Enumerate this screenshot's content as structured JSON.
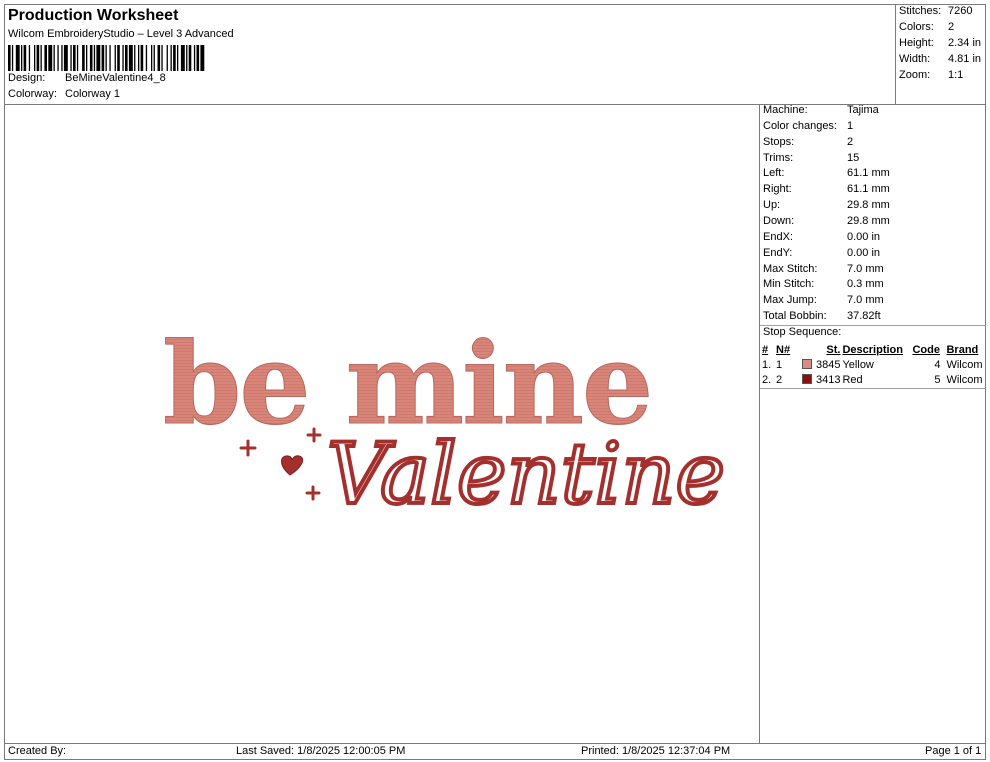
{
  "header": {
    "title": "Production Worksheet",
    "subtitle": "Wilcom EmbroideryStudio – Level 3 Advanced",
    "design_label": "Design:",
    "design_value": "BeMineValentine4_8",
    "colorway_label": "Colorway:",
    "colorway_value": "Colorway 1"
  },
  "summary": {
    "stitches_label": "Stitches:",
    "stitches_value": "7260",
    "colors_label": "Colors:",
    "colors_value": "2",
    "height_label": "Height:",
    "height_value": "2.34 in",
    "width_label": "Width:",
    "width_value": "4.81 in",
    "zoom_label": "Zoom:",
    "zoom_value": "1:1"
  },
  "machine_stats": [
    {
      "label": "Machine:",
      "value": "Tajima"
    },
    {
      "label": "Color changes:",
      "value": "1"
    },
    {
      "label": "Stops:",
      "value": "2"
    },
    {
      "label": "Trims:",
      "value": "15"
    },
    {
      "label": "Left:",
      "value": "61.1 mm"
    },
    {
      "label": "Right:",
      "value": "61.1 mm"
    },
    {
      "label": "Up:",
      "value": "29.8 mm"
    },
    {
      "label": "Down:",
      "value": "29.8 mm"
    },
    {
      "label": "EndX:",
      "value": "0.00 in"
    },
    {
      "label": "EndY:",
      "value": "0.00 in"
    },
    {
      "label": "Max Stitch:",
      "value": "7.0 mm"
    },
    {
      "label": "Min Stitch:",
      "value": "0.3 mm"
    },
    {
      "label": "Max Jump:",
      "value": "7.0 mm"
    },
    {
      "label": "Total Bobbin:",
      "value": "37.82ft"
    }
  ],
  "stop_sequence": {
    "label": "Stop Sequence:",
    "headers": {
      "idx": "#",
      "n": "N#",
      "st": "St.",
      "description": "Description",
      "code": "Code",
      "brand": "Brand"
    },
    "rows": [
      {
        "idx": "1.",
        "n": "1",
        "color": "#d98c82",
        "st": "3845",
        "description": "Yellow",
        "code": "4",
        "brand": "Wilcom"
      },
      {
        "idx": "2.",
        "n": "2",
        "color": "#8b0f0f",
        "st": "3413",
        "description": "Red",
        "code": "5",
        "brand": "Wilcom"
      }
    ]
  },
  "design_art": {
    "line1": "be mine",
    "line2": "Valentine",
    "line1_color": "#d9857a",
    "line2_color": "#a4302e"
  },
  "footer": {
    "created_by": "Created By:",
    "last_saved": "Last Saved: 1/8/2025 12:00:05 PM",
    "printed": "Printed: 1/8/2025 12:37:04 PM",
    "page": "Page 1 of 1"
  }
}
